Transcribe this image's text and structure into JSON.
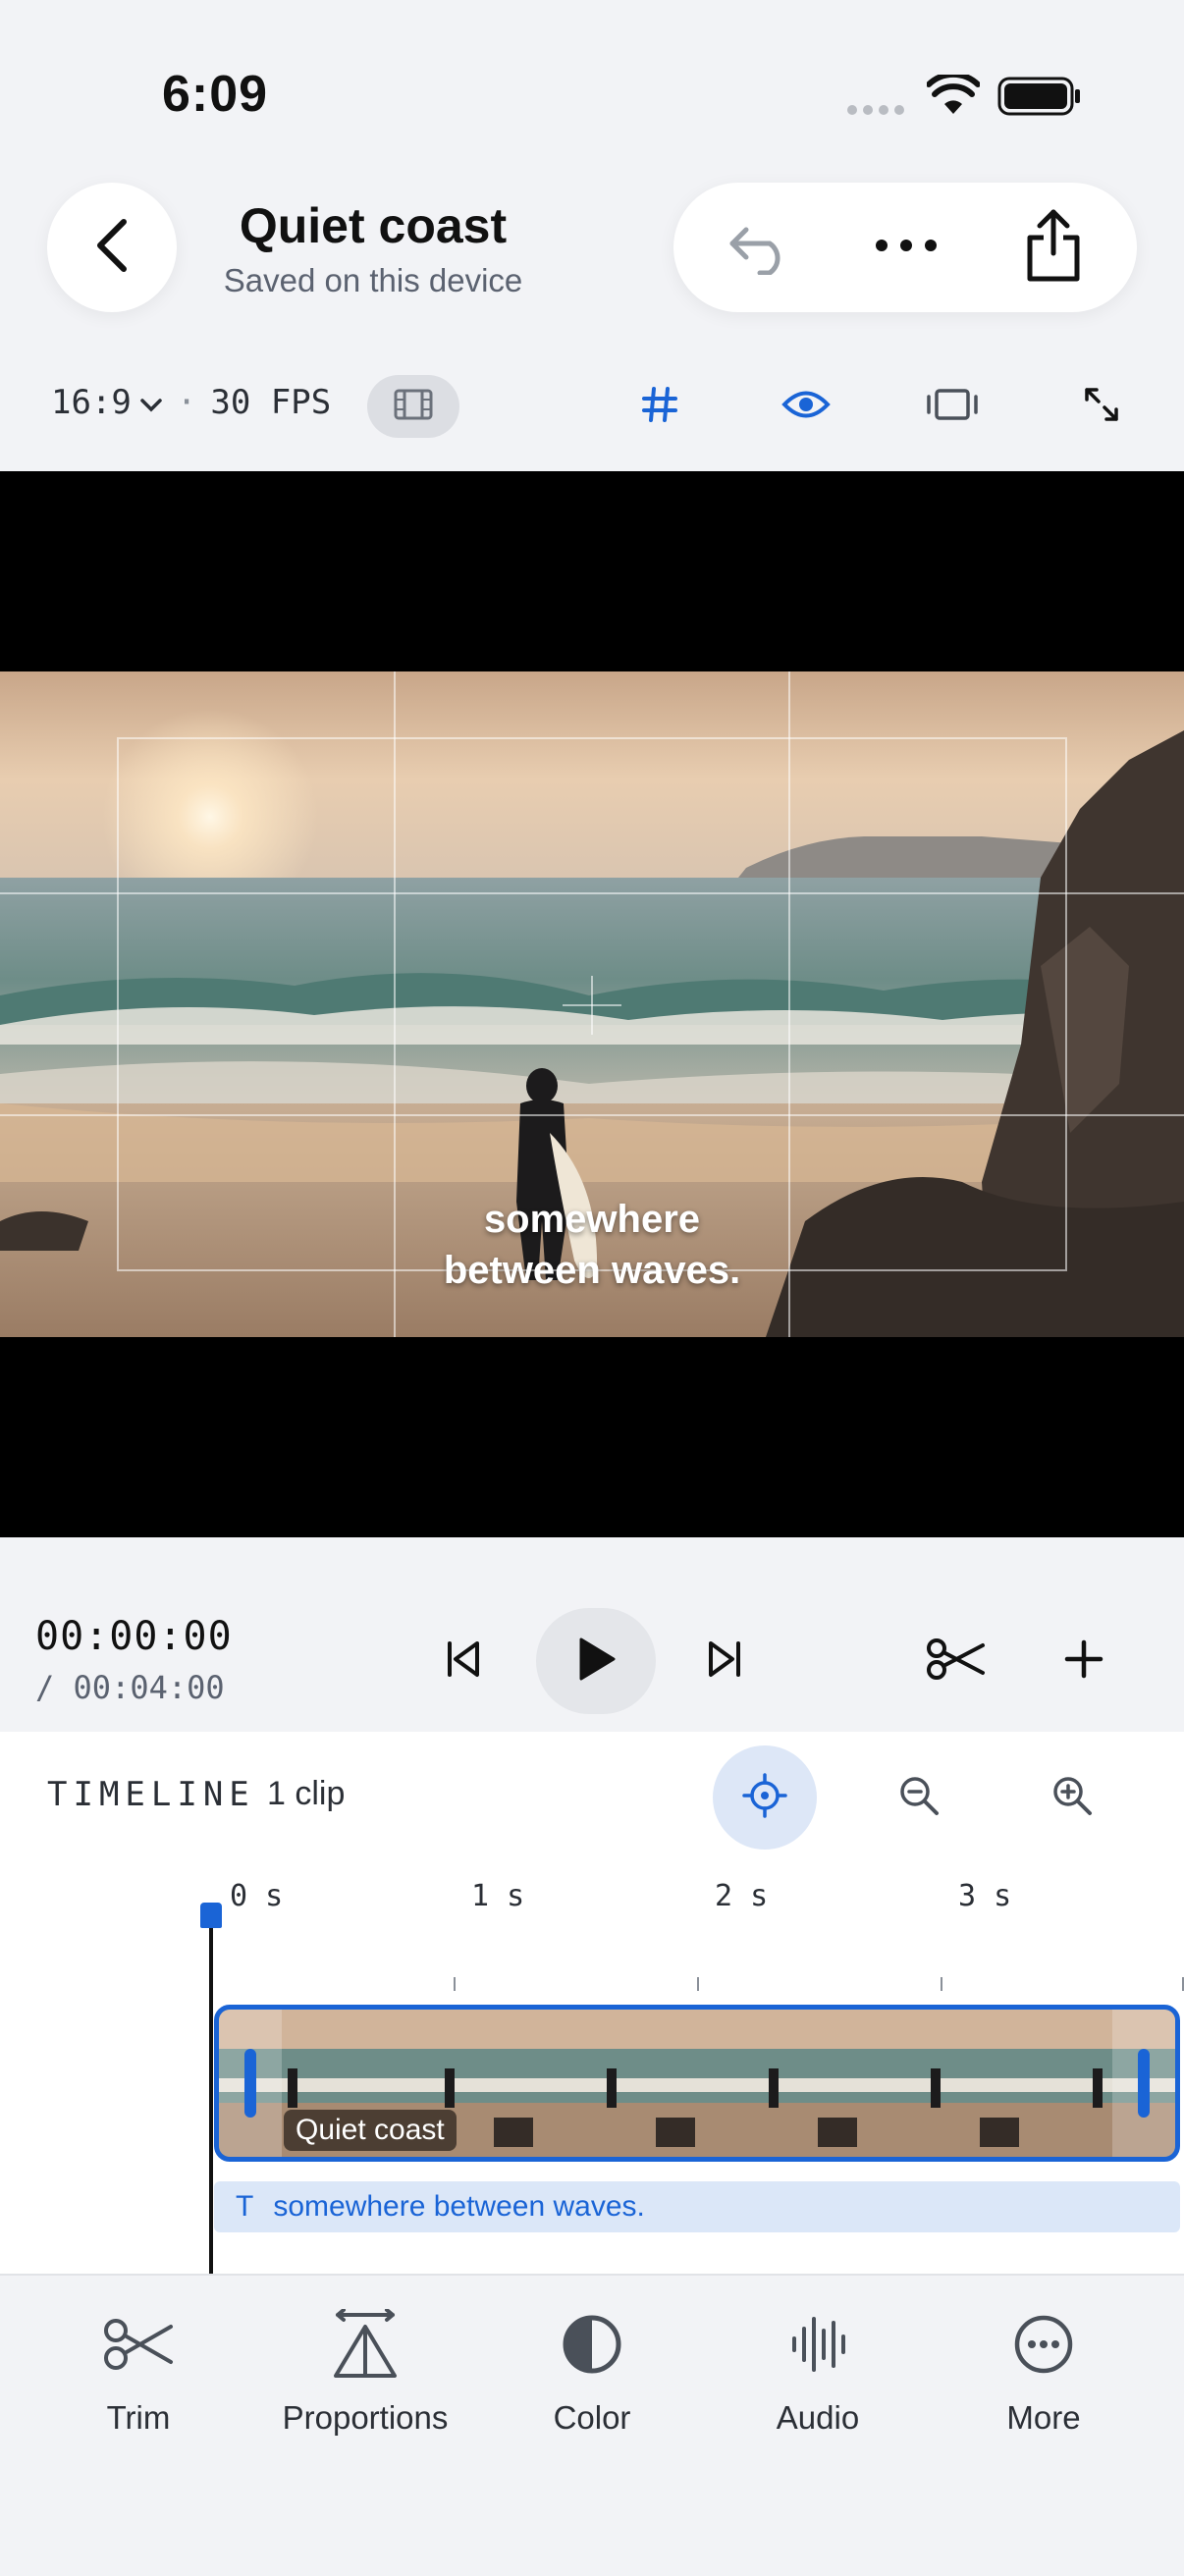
{
  "status_bar": {
    "time": "6:09"
  },
  "header": {
    "back_icon": "chevron-left-icon",
    "title": "Quiet coast",
    "subtitle": "Saved on this device",
    "actions": [
      "undo-icon",
      "more-horizontal-icon",
      "share-icon"
    ]
  },
  "toolbar": {
    "aspect": "16:9",
    "separator": "·",
    "fps": "30 FPS",
    "icons": [
      "film-icon",
      "grid-icon",
      "eye-icon",
      "frame-icon",
      "expand-icon"
    ],
    "accent": "#1a64d6"
  },
  "preview": {
    "caption_line1": "somewhere",
    "caption_line2": "between waves."
  },
  "transport": {
    "current": "00:00:00",
    "total": "/ 00:04:00",
    "icons": [
      "skip-back-icon",
      "play-icon",
      "skip-forward-icon",
      "scissors-icon",
      "plus-icon"
    ]
  },
  "timeline": {
    "label": "TIMELINE",
    "count": "1 clip",
    "icons": [
      "target-icon",
      "zoom-out-icon",
      "zoom-in-icon"
    ],
    "ruler": [
      "0 s",
      "1 s",
      "2 s",
      "3 s"
    ],
    "clip_name": "Quiet coast",
    "text_track_glyph": "T",
    "text_track_label": "somewhere between waves."
  },
  "tabs": [
    {
      "label": "Trim",
      "icon": "scissors-icon"
    },
    {
      "label": "Proportions",
      "icon": "proportions-icon"
    },
    {
      "label": "Color",
      "icon": "contrast-icon"
    },
    {
      "label": "Audio",
      "icon": "waveform-icon"
    },
    {
      "label": "More",
      "icon": "more-circle-icon"
    }
  ]
}
